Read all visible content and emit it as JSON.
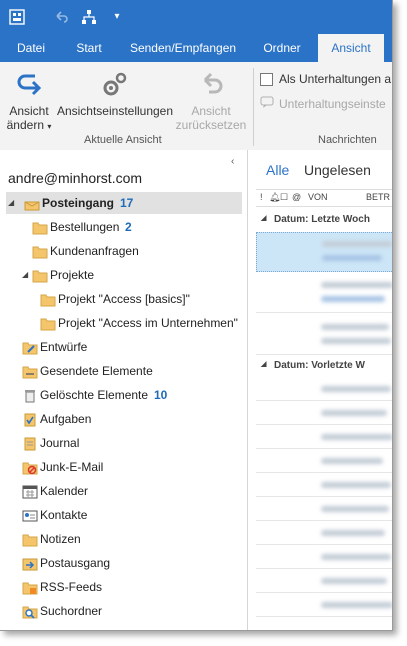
{
  "tabs": [
    "Datei",
    "Start",
    "Senden/Empfangen",
    "Ordner",
    "Ansicht"
  ],
  "active_tab": "Ansicht",
  "ribbon": {
    "change_view": "Ansicht\nändern",
    "change_view_l1": "Ansicht",
    "change_view_l2": "ändern",
    "view_settings": "Ansichtseinstellungen",
    "reset_view_l1": "Ansicht",
    "reset_view_l2": "zurücksetzen",
    "group_current_view": "Aktuelle Ansicht",
    "show_as_conversations": "Als Unterhaltungen a",
    "conversation_settings": "Unterhaltungseinste",
    "group_messages": "Nachrichten"
  },
  "account": "andre@minhorst.com",
  "folders": [
    {
      "name": "Posteingang",
      "count": "17",
      "bold": true
    },
    {
      "name": "Bestellungen",
      "count": "2"
    },
    {
      "name": "Kundenanfragen"
    },
    {
      "name": "Projekte"
    },
    {
      "name": "Projekt \"Access [basics]\""
    },
    {
      "name": "Projekt \"Access im Unternehmen\""
    },
    {
      "name": "Entwürfe"
    },
    {
      "name": "Gesendete Elemente"
    },
    {
      "name": "Gelöschte Elemente",
      "count": "10"
    },
    {
      "name": "Aufgaben"
    },
    {
      "name": "Journal"
    },
    {
      "name": "Junk-E-Mail"
    },
    {
      "name": "Kalender"
    },
    {
      "name": "Kontakte"
    },
    {
      "name": "Notizen"
    },
    {
      "name": "Postausgang"
    },
    {
      "name": "RSS-Feeds"
    },
    {
      "name": "Suchordner"
    }
  ],
  "mail": {
    "filter_all": "Alle",
    "filter_unread": "Ungelesen",
    "col_from": "VON",
    "col_subject": "BETR",
    "group1": "Datum: Letzte Woch",
    "group2": "Datum: Vorletzte W"
  },
  "colors": {
    "accent": "#2b73c7",
    "count": "#1e6bb8"
  }
}
